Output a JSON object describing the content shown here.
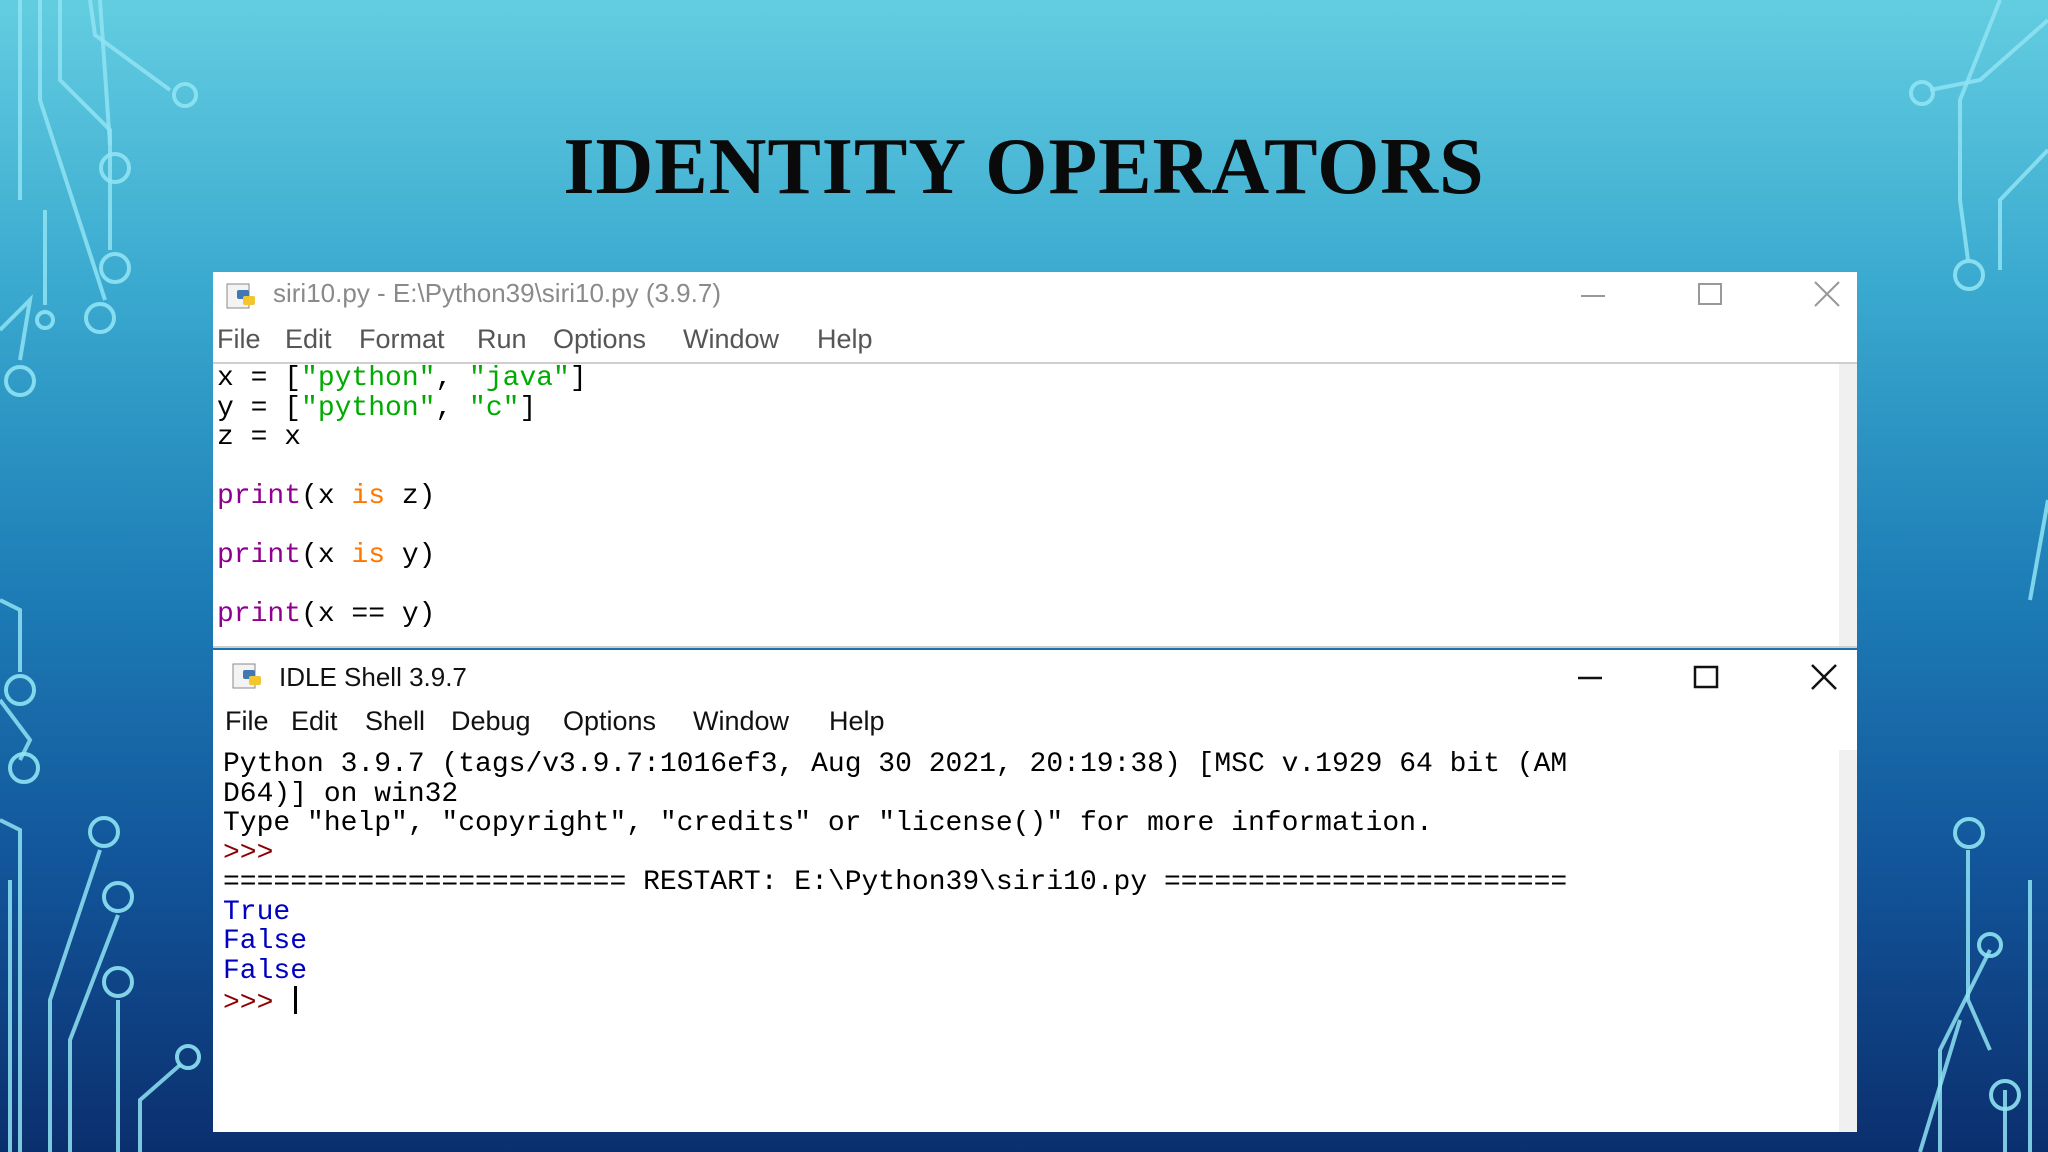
{
  "slide": {
    "title": "IDENTITY OPERATORS"
  },
  "editor": {
    "title": "siri10.py - E:\\Python39\\siri10.py (3.9.7)",
    "menu": [
      "File",
      "Edit",
      "Format",
      "Run",
      "Options",
      "Window",
      "Help"
    ],
    "lines": {
      "l1_a": "x = [",
      "l1_s1": "\"python\"",
      "l1_b": ", ",
      "l1_s2": "\"java\"",
      "l1_c": "]",
      "l2_a": "y = [",
      "l2_s1": "\"python\"",
      "l2_b": ", ",
      "l2_s2": "\"c\"",
      "l2_c": "]",
      "l3": "z = x",
      "p1_fn": "print",
      "p1_a": "(x ",
      "p1_kw": "is",
      "p1_b": " z)",
      "p2_fn": "print",
      "p2_a": "(x ",
      "p2_kw": "is",
      "p2_b": " y)",
      "p3_fn": "print",
      "p3_a": "(x == y)"
    }
  },
  "shell": {
    "title": "IDLE Shell 3.9.7",
    "menu": [
      "File",
      "Edit",
      "Shell",
      "Debug",
      "Options",
      "Window",
      "Help"
    ],
    "banner1": "Python 3.9.7 (tags/v3.9.7:1016ef3, Aug 30 2021, 20:19:38) [MSC v.1929 64 bit (AM",
    "banner2": "D64)] on win32",
    "banner3": "Type \"help\", \"copyright\", \"credits\" or \"license()\" for more information.",
    "prompt": ">>>",
    "restart": "======================== RESTART: E:\\Python39\\siri10.py ========================",
    "outputs": [
      "True",
      "False",
      "False"
    ],
    "prompt2": ">>> "
  },
  "colors": {
    "builtin": "#900090",
    "keyword": "#ff7700",
    "string": "#00aa00",
    "output": "#0000c0",
    "prompt": "#8b0000"
  }
}
